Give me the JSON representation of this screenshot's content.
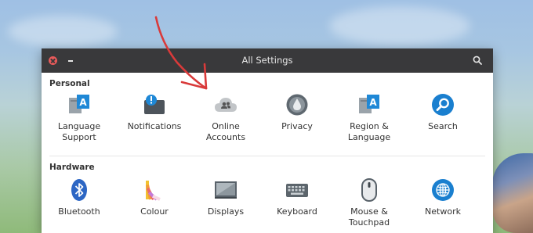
{
  "window": {
    "title": "All Settings"
  },
  "sections": {
    "personal": {
      "title": "Personal",
      "items": [
        {
          "label": "Language\nSupport",
          "icon": "language-support-icon"
        },
        {
          "label": "Notifications",
          "icon": "notifications-icon"
        },
        {
          "label": "Online\nAccounts",
          "icon": "online-accounts-icon"
        },
        {
          "label": "Privacy",
          "icon": "privacy-icon"
        },
        {
          "label": "Region &\nLanguage",
          "icon": "region-language-icon"
        },
        {
          "label": "Search",
          "icon": "search-icon"
        }
      ]
    },
    "hardware": {
      "title": "Hardware",
      "items": [
        {
          "label": "Bluetooth",
          "icon": "bluetooth-icon"
        },
        {
          "label": "Colour",
          "icon": "colour-icon"
        },
        {
          "label": "Displays",
          "icon": "displays-icon"
        },
        {
          "label": "Keyboard",
          "icon": "keyboard-icon"
        },
        {
          "label": "Mouse &\nTouchpad",
          "icon": "mouse-icon"
        },
        {
          "label": "Network",
          "icon": "network-icon"
        }
      ]
    }
  },
  "colors": {
    "titlebar": "#39393b",
    "accent_blue": "#1f88d6",
    "annotation_arrow": "#d93a3a"
  }
}
